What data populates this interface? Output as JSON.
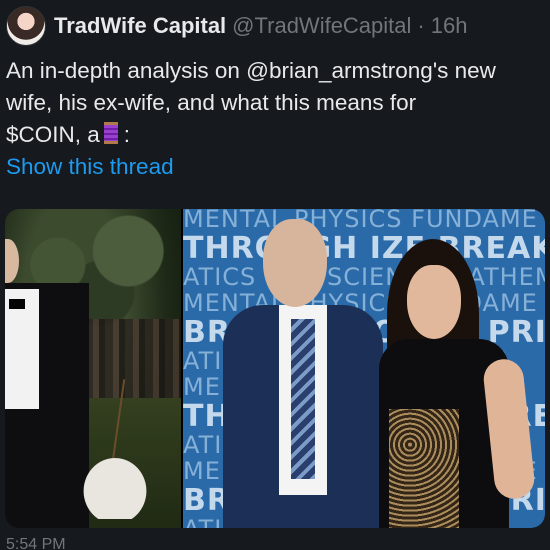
{
  "tweet": {
    "display_name": "TradWife Capital",
    "handle": "@TradWifeCapital",
    "separator": "·",
    "time_ago": "16h",
    "text_lines": [
      "An in-depth analysis on @brian_armstrong's new",
      "wife, his ex-wife, and what this means for",
      "$COIN, a",
      ":"
    ],
    "show_thread_label": "Show this thread",
    "footer_time": "5:54 PM"
  },
  "media": {
    "backdrop_rows": [
      "MENTAL PHYSICS FUNDAME",
      "THROUGH  IZE  BREAKTH",
      "ATICS LIFE SCIENCE MATHEMATI",
      "MENTAL PHYSICS FUNDAME",
      "BREAKTHROUGH PRIZE BR",
      "ATICS LIFE SCIENCE MATI",
      "MENTAL PHYSICS FUNDAM",
      "THROUGH PRIZE BREAKTH",
      "ATICS LIFE SCIENCE MATI",
      "MENTAL PHYSICS FUNDAME",
      "BREAKTHROUGH PRIZE BRE",
      "ATICS LIFE SCIENCE MATI"
    ]
  },
  "icons": {
    "thread_emoji": "thread-spool-icon"
  },
  "colors": {
    "background": "#16191d",
    "text": "#e7e9ea",
    "secondary": "#71767b",
    "link": "#1d9bf0"
  }
}
